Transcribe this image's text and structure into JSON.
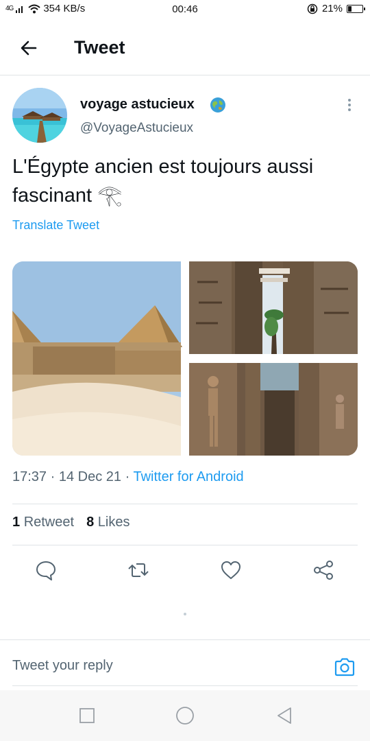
{
  "status_bar": {
    "signal": "4G",
    "speed": "354 KB/s",
    "time": "00:46",
    "battery": "21%",
    "battery_level": 0.21
  },
  "header": {
    "title": "Tweet"
  },
  "tweet": {
    "user_name": "voyage astucieux",
    "handle": "@VoyageAstucieux",
    "text": "L'Égypte ancien est toujours aussi fascinant 𓂀",
    "translate_label": "Translate Tweet",
    "time": "17:37",
    "separator": "·",
    "date": "14 Dec 21",
    "source": "Twitter for Android",
    "retweets_count": "1",
    "retweets_label": "Retweet",
    "likes_count": "8",
    "likes_label": "Likes"
  },
  "reply": {
    "placeholder": "Tweet your reply"
  },
  "icons": {
    "back": "arrow-left-icon",
    "verified": "globe-icon",
    "more": "more-vertical-icon",
    "reply": "comment-icon",
    "retweet": "retweet-icon",
    "like": "heart-icon",
    "share": "share-icon",
    "camera": "camera-icon"
  },
  "colors": {
    "accent": "#1d9bf0",
    "text_primary": "#0f1419",
    "text_secondary": "#536471",
    "divider": "#dfe3e6"
  }
}
